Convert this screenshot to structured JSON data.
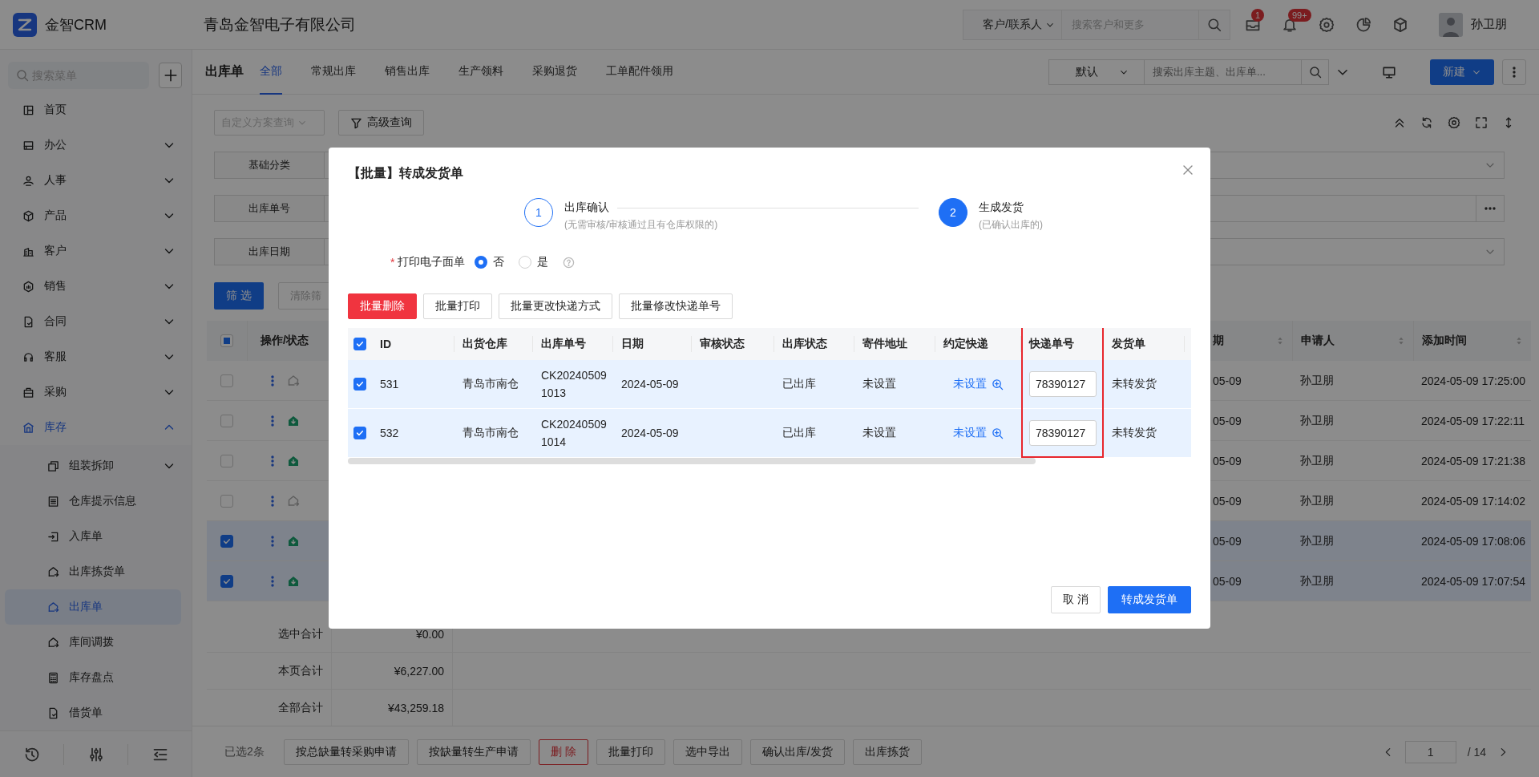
{
  "header": {
    "brand": "金智CRM",
    "company": "青岛金智电子有限公司",
    "search": {
      "scope": "客户/联系人",
      "placeholder": "搜索客户和更多"
    },
    "notifications": [
      {
        "count": "1"
      },
      {
        "count": "99+"
      }
    ],
    "user": "孙卫朋"
  },
  "sidebar": {
    "search_placeholder": "搜索菜单",
    "items": [
      {
        "label": "首页",
        "selected": false
      },
      {
        "label": "办公",
        "selected": false,
        "expanded": false
      },
      {
        "label": "人事",
        "selected": false,
        "expanded": false
      },
      {
        "label": "产品",
        "selected": false,
        "expanded": false
      },
      {
        "label": "客户",
        "selected": false,
        "expanded": false
      },
      {
        "label": "销售",
        "selected": false,
        "expanded": false
      },
      {
        "label": "合同",
        "selected": false,
        "expanded": false
      },
      {
        "label": "客服",
        "selected": false,
        "expanded": false
      },
      {
        "label": "采购",
        "selected": false,
        "expanded": false
      },
      {
        "label": "库存",
        "selected": true,
        "expanded": true,
        "children": [
          {
            "label": "组装拆卸",
            "selected": false,
            "expanded": false
          },
          {
            "label": "仓库提示信息",
            "selected": false
          },
          {
            "label": "入库单",
            "selected": false
          },
          {
            "label": "出库拣货单",
            "selected": false
          },
          {
            "label": "出库单",
            "selected": true
          },
          {
            "label": "库间调拨",
            "selected": false
          },
          {
            "label": "库存盘点",
            "selected": false
          },
          {
            "label": "借货单",
            "selected": false
          }
        ]
      }
    ]
  },
  "page": {
    "title": "出库单",
    "tabs": [
      {
        "label": "全部",
        "selected": true
      },
      {
        "label": "常规出库",
        "selected": false
      },
      {
        "label": "销售出库",
        "selected": false
      },
      {
        "label": "生产领料",
        "selected": false
      },
      {
        "label": "采购退货",
        "selected": false
      },
      {
        "label": "工单配件领用",
        "selected": false
      }
    ],
    "view": "默认",
    "search_placeholder": "搜索出库主题、出库单...",
    "new_button": "新建"
  },
  "filters": {
    "scheme_placeholder": "自定义方案查询",
    "advanced": "高级查询",
    "fields": [
      {
        "label": "基础分类",
        "kind": "select"
      },
      {
        "label": "出库单号",
        "kind": "text"
      },
      {
        "label": "出库日期",
        "kind": "select"
      }
    ],
    "apply": "筛 选",
    "clear": "清除筛"
  },
  "table": {
    "indeterminate": true,
    "columns": [
      {
        "label": "操作/状态"
      },
      {
        "label": "期",
        "sortable": true
      },
      {
        "label": "申请人",
        "sortable": true
      },
      {
        "label": "添加时间",
        "sortable": true
      }
    ],
    "rows": [
      {
        "checked": false,
        "confirmed": false,
        "date": "05-09",
        "applicant": "孙卫朋",
        "added": "2024-05-09 17:25:00"
      },
      {
        "checked": false,
        "confirmed": true,
        "date": "05-09",
        "applicant": "孙卫朋",
        "added": "2024-05-09 17:22:11"
      },
      {
        "checked": false,
        "confirmed": true,
        "date": "05-09",
        "applicant": "孙卫朋",
        "added": "2024-05-09 17:21:38"
      },
      {
        "checked": false,
        "confirmed": false,
        "date": "05-09",
        "applicant": "孙卫朋",
        "added": "2024-05-09 17:14:02"
      },
      {
        "checked": true,
        "confirmed": true,
        "date": "05-09",
        "applicant": "孙卫朋",
        "added": "2024-05-09 17:08:06"
      },
      {
        "checked": true,
        "confirmed": true,
        "date": "05-09",
        "applicant": "孙卫朋",
        "added": "2024-05-09 17:07:54"
      }
    ],
    "totals": [
      {
        "label": "选中合计",
        "amount": "¥0.00"
      },
      {
        "label": "本页合计",
        "amount": "¥6,227.00"
      },
      {
        "label": "全部合计",
        "amount": "¥43,259.18"
      }
    ]
  },
  "footer": {
    "selected_count": "已选2条",
    "actions": [
      {
        "label": "按总缺量转采购申请",
        "kind": "default"
      },
      {
        "label": "按缺量转生产申请",
        "kind": "default"
      },
      {
        "label": "删 除",
        "kind": "danger"
      },
      {
        "label": "批量打印",
        "kind": "default"
      },
      {
        "label": "选中导出",
        "kind": "default"
      },
      {
        "label": "确认出库/发货",
        "kind": "default"
      },
      {
        "label": "出库拣货",
        "kind": "default"
      }
    ],
    "page": "1",
    "total_pages": "/ 14"
  },
  "dialog": {
    "title": "【批量】转成发货单",
    "steps": [
      {
        "number": "1",
        "title": "出库确认",
        "description": "(无需审核/审核通过且有仓库权限的)",
        "selected": false
      },
      {
        "number": "2",
        "title": "生成发货",
        "description": "(已确认出库的)",
        "selected": true
      }
    ],
    "print_option": {
      "required_mark": "*",
      "label": "打印电子面单",
      "options": [
        {
          "label": "否",
          "selected": true
        },
        {
          "label": "是",
          "selected": false
        }
      ]
    },
    "actions": [
      {
        "label": "批量删除",
        "kind": "danger"
      },
      {
        "label": "批量打印",
        "kind": "default"
      },
      {
        "label": "批量更改快递方式",
        "kind": "default"
      },
      {
        "label": "批量修改快递单号",
        "kind": "default"
      }
    ],
    "table": {
      "all_checked": true,
      "columns": [
        {
          "label": "ID"
        },
        {
          "label": "出货仓库"
        },
        {
          "label": "出库单号"
        },
        {
          "label": "日期"
        },
        {
          "label": "审核状态"
        },
        {
          "label": "出库状态"
        },
        {
          "label": "寄件地址"
        },
        {
          "label": "约定快递"
        },
        {
          "label": "快递单号",
          "highlighted": true
        },
        {
          "label": "发货单"
        }
      ],
      "rows": [
        {
          "checked": true,
          "id": "531",
          "warehouse": "青岛市南仓",
          "number": "CK202405091013",
          "date": "2024-05-09",
          "status": "已出库",
          "address": "未设置",
          "courier": "未设置",
          "tracking": "78390127",
          "invoice": "未转发货"
        },
        {
          "checked": true,
          "id": "532",
          "warehouse": "青岛市南仓",
          "number": "CK202405091014",
          "date": "2024-05-09",
          "status": "已出库",
          "address": "未设置",
          "courier": "未设置",
          "tracking": "78390127",
          "invoice": "未转发货"
        }
      ]
    },
    "cancel": "取 消",
    "confirm": "转成发货单"
  }
}
